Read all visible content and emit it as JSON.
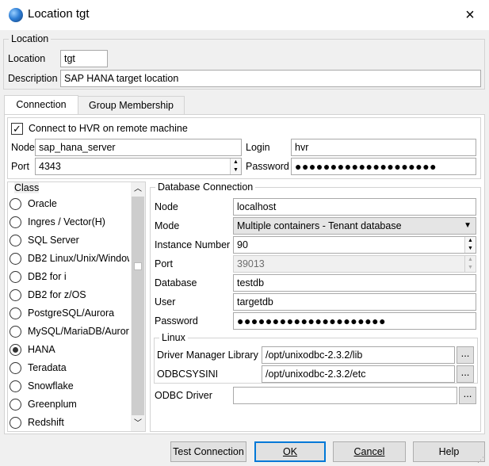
{
  "window": {
    "title": "Location tgt",
    "close_icon": "×"
  },
  "location": {
    "group_label": "Location",
    "location_label": "Location",
    "location_value": "tgt",
    "description_label": "Description",
    "description_value": "SAP HANA target location"
  },
  "tabs": [
    {
      "label": "Connection",
      "active": true
    },
    {
      "label": "Group Membership",
      "active": false
    }
  ],
  "remote": {
    "checkbox_label": "Connect to HVR on remote machine",
    "checked": true,
    "node_label": "Node",
    "node_value": "sap_hana_server",
    "login_label": "Login",
    "login_value": "hvr",
    "port_label": "Port",
    "port_value": "4343",
    "password_label": "Password",
    "password_value": "●●●●●●●●●●●●●●●●●●●●"
  },
  "class_list": {
    "title": "Class",
    "items": [
      {
        "label": "Oracle",
        "selected": false
      },
      {
        "label": "Ingres / Vector(H)",
        "selected": false
      },
      {
        "label": "SQL Server",
        "selected": false
      },
      {
        "label": "DB2 Linux/Unix/Window",
        "selected": false
      },
      {
        "label": "DB2 for i",
        "selected": false
      },
      {
        "label": "DB2 for z/OS",
        "selected": false
      },
      {
        "label": "PostgreSQL/Aurora",
        "selected": false
      },
      {
        "label": "MySQL/MariaDB/Auror",
        "selected": false
      },
      {
        "label": "HANA",
        "selected": true
      },
      {
        "label": "Teradata",
        "selected": false
      },
      {
        "label": "Snowflake",
        "selected": false
      },
      {
        "label": "Greenplum",
        "selected": false
      },
      {
        "label": "Redshift",
        "selected": false
      }
    ]
  },
  "db": {
    "group_label": "Database Connection",
    "node_label": "Node",
    "node_value": "localhost",
    "mode_label": "Mode",
    "mode_value": "Multiple containers - Tenant database",
    "instance_label": "Instance Number",
    "instance_value": "90",
    "port_label": "Port",
    "port_value": "39013",
    "database_label": "Database",
    "database_value": "testdb",
    "user_label": "User",
    "user_value": "targetdb",
    "password_label": "Password",
    "password_value": "●●●●●●●●●●●●●●●●●●●●●"
  },
  "linux": {
    "group_label": "Linux",
    "driver_manager_label": "Driver Manager Library",
    "driver_manager_value": "/opt/unixodbc-2.3.2/lib",
    "odbcsysini_label": "ODBCSYSINI",
    "odbcsysini_value": "/opt/unixodbc-2.3.2/etc",
    "browse_label": "..."
  },
  "odbc": {
    "driver_label": "ODBC Driver",
    "driver_value": "",
    "browse_label": "..."
  },
  "buttons": {
    "test_connection": "Test Connection",
    "ok": "OK",
    "cancel": "Cancel",
    "help": "Help"
  },
  "colors": {
    "accent": "#0078d7",
    "background": "#f0f0f0"
  }
}
